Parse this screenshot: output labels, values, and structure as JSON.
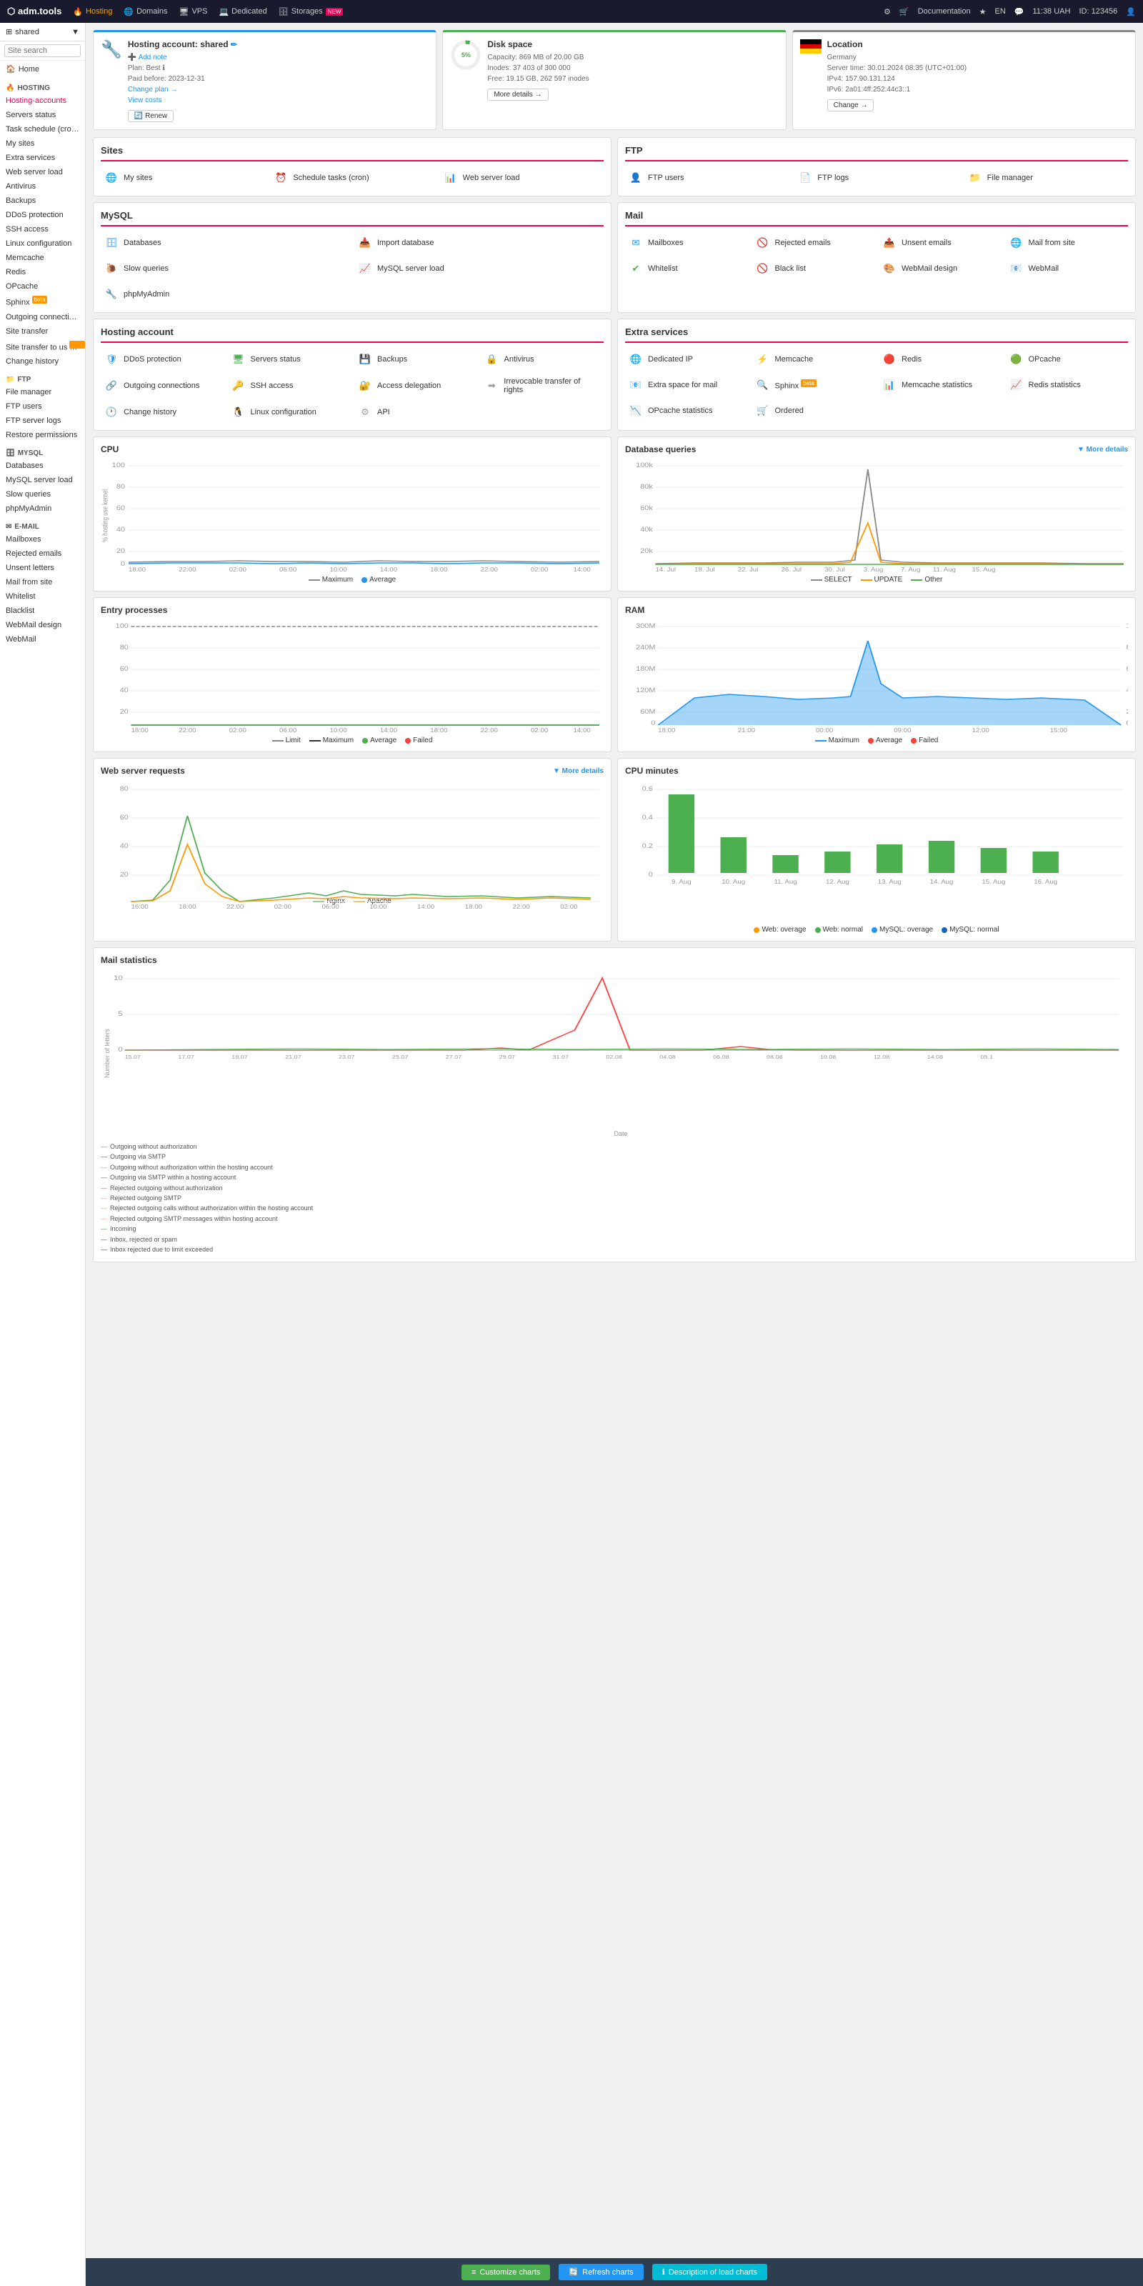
{
  "topNav": {
    "logo": "⬡ adm.tools",
    "items": [
      {
        "label": "Hosting",
        "icon": "🔥",
        "active": true
      },
      {
        "label": "Domains",
        "icon": "🌐",
        "active": false
      },
      {
        "label": "VPS",
        "icon": "🖥",
        "active": false
      },
      {
        "label": "Dedicated",
        "icon": "💻",
        "active": false
      },
      {
        "label": "Storages",
        "icon": "🗄",
        "active": false,
        "badge": "NEW"
      }
    ],
    "right": {
      "settings": "⚙",
      "cart": "🛒",
      "docs": "Documentation",
      "star": "★",
      "lang": "EN",
      "chat": "💬",
      "time": "11:38 UAH",
      "id": "ID: 123456",
      "avatar": "👤"
    }
  },
  "sidebar": {
    "account": "shared",
    "search_placeholder": "Site search",
    "home_label": "Home",
    "sections": [
      {
        "title": "HOSTING",
        "items": [
          "Hosting-accounts",
          "Servers status",
          "Task schedule (crontab)",
          "My sites",
          "Extra services",
          "Web server load",
          "Antivirus",
          "Backups",
          "DDoS protection",
          "SSH access",
          "Linux configuration",
          "Memcache",
          "Redis",
          "OPcache",
          "Sphinx ᵝeta",
          "Outgoing connections",
          "Site transfer",
          "Site transfer to us ᵝeta",
          "Change history"
        ]
      },
      {
        "title": "FTP",
        "items": [
          "File manager",
          "FTP users",
          "FTP server logs",
          "Restore permissions"
        ]
      },
      {
        "title": "MYSQL",
        "items": [
          "Databases",
          "MySQL server load",
          "Slow queries",
          "phpMyAdmin"
        ]
      },
      {
        "title": "E-MAIL",
        "items": [
          "Mailboxes",
          "Rejected emails",
          "Unsent letters",
          "Mail from site",
          "Whitelist",
          "Blacklist",
          "WebMail design",
          "WebMail"
        ]
      }
    ]
  },
  "headerCards": {
    "hosting": {
      "title": "Hosting account: shared",
      "plan": "Plan: Best",
      "paid": "Paid before: 2023-12-31",
      "change_plan": "Change plan →",
      "view_costs": "View costs",
      "renew": "Renew"
    },
    "disk": {
      "label": "Disk space",
      "pct": "5%",
      "capacity": "Capacity: 869 MB of 20.00 GB",
      "inodes": "Inodes: 37 403 of 300 000",
      "free": "Free: 19.15 GB, 262 597 inodes",
      "more_details": "More details →"
    },
    "location": {
      "title": "Location",
      "country": "Germany",
      "server_time": "Server time: 30.01.2024 08:35 (UTC+01:00)",
      "ipv4": "IPv4: 157.90.131.124",
      "ipv6": "IPv6: 2a01:4ff:252:44c3::1",
      "change": "Change →"
    }
  },
  "sections": {
    "sites": {
      "title": "Sites",
      "items": [
        {
          "label": "My sites",
          "icon": "🌐"
        },
        {
          "label": "Schedule tasks (cron)",
          "icon": "⏰"
        },
        {
          "label": "Web server load",
          "icon": "📊"
        }
      ]
    },
    "ftp": {
      "title": "FTP",
      "items": [
        {
          "label": "FTP users",
          "icon": "👤"
        },
        {
          "label": "FTP logs",
          "icon": "📄"
        },
        {
          "label": "File manager",
          "icon": "📁"
        }
      ]
    },
    "mysql": {
      "title": "MySQL",
      "items": [
        {
          "label": "Databases",
          "icon": "🗄"
        },
        {
          "label": "Import database",
          "icon": "📥"
        },
        {
          "label": "Slow queries",
          "icon": "🐌"
        },
        {
          "label": "MySQL server load",
          "icon": "📈"
        },
        {
          "label": "phpMyAdmin",
          "icon": "🔧"
        }
      ]
    },
    "mail": {
      "title": "Mail",
      "items": [
        {
          "label": "Mailboxes",
          "icon": "✉"
        },
        {
          "label": "Rejected emails",
          "icon": "🚫"
        },
        {
          "label": "Unsent emails",
          "icon": "📤"
        },
        {
          "label": "Mail from site",
          "icon": "🌐"
        },
        {
          "label": "Whitelist",
          "icon": "✔"
        },
        {
          "label": "Black list",
          "icon": "🚫"
        },
        {
          "label": "WebMail design",
          "icon": "🎨"
        },
        {
          "label": "WebMail",
          "icon": "📧"
        }
      ]
    },
    "hostingAccount": {
      "title": "Hosting account",
      "items": [
        {
          "label": "DDoS protection",
          "icon": "🛡"
        },
        {
          "label": "Servers status",
          "icon": "🖥"
        },
        {
          "label": "Backups",
          "icon": "💾"
        },
        {
          "label": "Antivirus",
          "icon": "🔒"
        },
        {
          "label": "Outgoing connections",
          "icon": "🔗"
        },
        {
          "label": "SSH access",
          "icon": "🔑"
        },
        {
          "label": "Access delegation",
          "icon": "🔐"
        },
        {
          "label": "Irrevocable transfer of rights",
          "icon": "➡"
        },
        {
          "label": "Change history",
          "icon": "🕐"
        },
        {
          "label": "Linux configuration",
          "icon": "🐧"
        },
        {
          "label": "API",
          "icon": "⚙"
        }
      ]
    },
    "extraServices": {
      "title": "Extra services",
      "items": [
        {
          "label": "Dedicated IP",
          "icon": "🌐"
        },
        {
          "label": "Memcache",
          "icon": "⚡"
        },
        {
          "label": "Redis",
          "icon": "🔴"
        },
        {
          "label": "OPcache",
          "icon": "🟢"
        },
        {
          "label": "Extra space for mail",
          "icon": "📧"
        },
        {
          "label": "Sphinx Beta",
          "icon": "🔍",
          "beta": true
        },
        {
          "label": "Memcache statistics",
          "icon": "📊"
        },
        {
          "label": "Redis statistics",
          "icon": "📈"
        },
        {
          "label": "OPcache statistics",
          "icon": "📉"
        },
        {
          "label": "Ordered",
          "icon": "🛒"
        }
      ]
    }
  },
  "charts": {
    "cpu": {
      "title": "CPU",
      "legend": [
        "Maximum",
        "Average"
      ],
      "colors": [
        "#888",
        "#2196F3"
      ]
    },
    "dbQueries": {
      "title": "Database queries",
      "more_details": "▼ More details",
      "legend": [
        "SELECT",
        "UPDATE",
        "Other"
      ],
      "colors": [
        "#888",
        "#FF9800",
        "#4CAF50"
      ]
    },
    "entryProcesses": {
      "title": "Entry processes",
      "legend": [
        "Limit",
        "Maximum",
        "Average",
        "Failed"
      ],
      "colors": [
        "#888",
        "#333",
        "#4CAF50",
        "#f44336"
      ]
    },
    "ram": {
      "title": "RAM",
      "legend": [
        "Maximum",
        "Average",
        "Failed"
      ],
      "colors": [
        "#2196F3",
        "#f44336",
        "#f44336"
      ]
    },
    "webServerRequests": {
      "title": "Web server requests",
      "more_details": "▼ More details",
      "legend": [
        "Nginx",
        "Apache"
      ],
      "colors": [
        "#4CAF50",
        "#FF9800"
      ]
    },
    "cpuMinutes": {
      "title": "CPU minutes",
      "legend": [
        "Web: overage",
        "Web: normal",
        "MySQL: overage",
        "MySQL: normal"
      ],
      "colors": [
        "#FF9800",
        "#4CAF50",
        "#2196F3",
        "#2196F3"
      ]
    },
    "mailStats": {
      "title": "Mail statistics",
      "xLabel": "Date",
      "yLabel": "Number of letters",
      "legend": [
        "Outgoing without authorization",
        "Outgoing via SMTP",
        "Outgoing without authorization within the hosting account",
        "Outgoing via SMTP within a hosting account",
        "Rejected outgoing without authorization",
        "Rejected outgoing SMTP",
        "Rejected outgoing calls without authorization within the hosting account",
        "Rejected outgoing SMTP messages within hosting account",
        "Incoming",
        "Inbox, rejected or spam",
        "Inbox rejected due to limit exceeded"
      ],
      "legendColors": [
        "#888",
        "#555",
        "#aaa",
        "#777",
        "#f44",
        "#f88",
        "#fa4",
        "#fa8",
        "#4a4",
        "#a44",
        "#44a"
      ]
    }
  },
  "bottomBar": {
    "customize": "Customize charts",
    "refresh": "Refresh charts",
    "description": "Description of load charts"
  }
}
